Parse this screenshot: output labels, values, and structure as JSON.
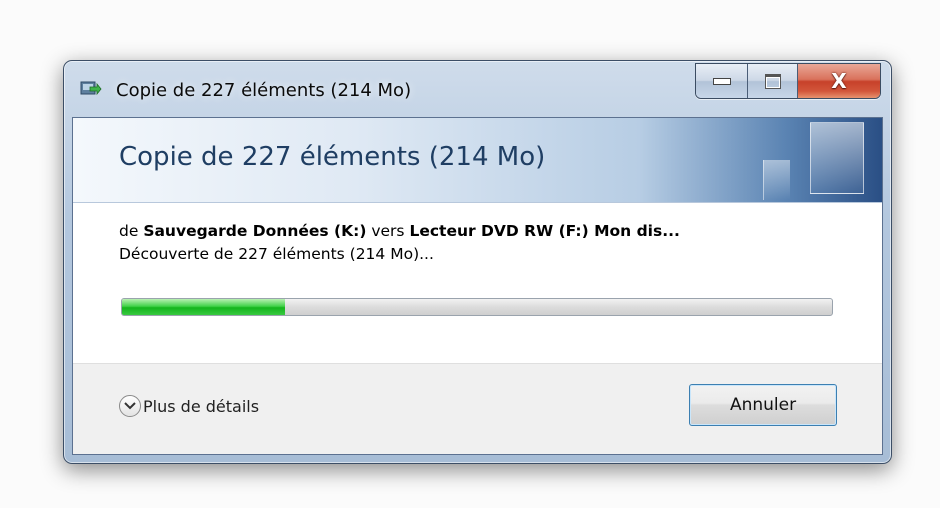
{
  "window": {
    "title": "Copie de 227 éléments (214 Mo)",
    "controls": {
      "minimize_icon": "minimize-icon",
      "maximize_icon": "maximize-icon",
      "close_icon": "close-icon",
      "close_glyph": "X"
    }
  },
  "header": {
    "title": "Copie de 227 éléments (214 Mo)"
  },
  "transfer": {
    "from_prefix": "de",
    "source": "Sauvegarde Données (K:)",
    "to_prefix": "vers",
    "destination": "Lecteur DVD RW (F:) Mon dis...",
    "status": "Découverte de 227 éléments (214 Mo)...",
    "progress_fraction": 0.23
  },
  "footer": {
    "details_label": "Plus de détails",
    "cancel_label": "Annuler"
  },
  "colors": {
    "progress": "#14b51c",
    "header_title": "#1f3e63",
    "close": "#c7412a"
  }
}
